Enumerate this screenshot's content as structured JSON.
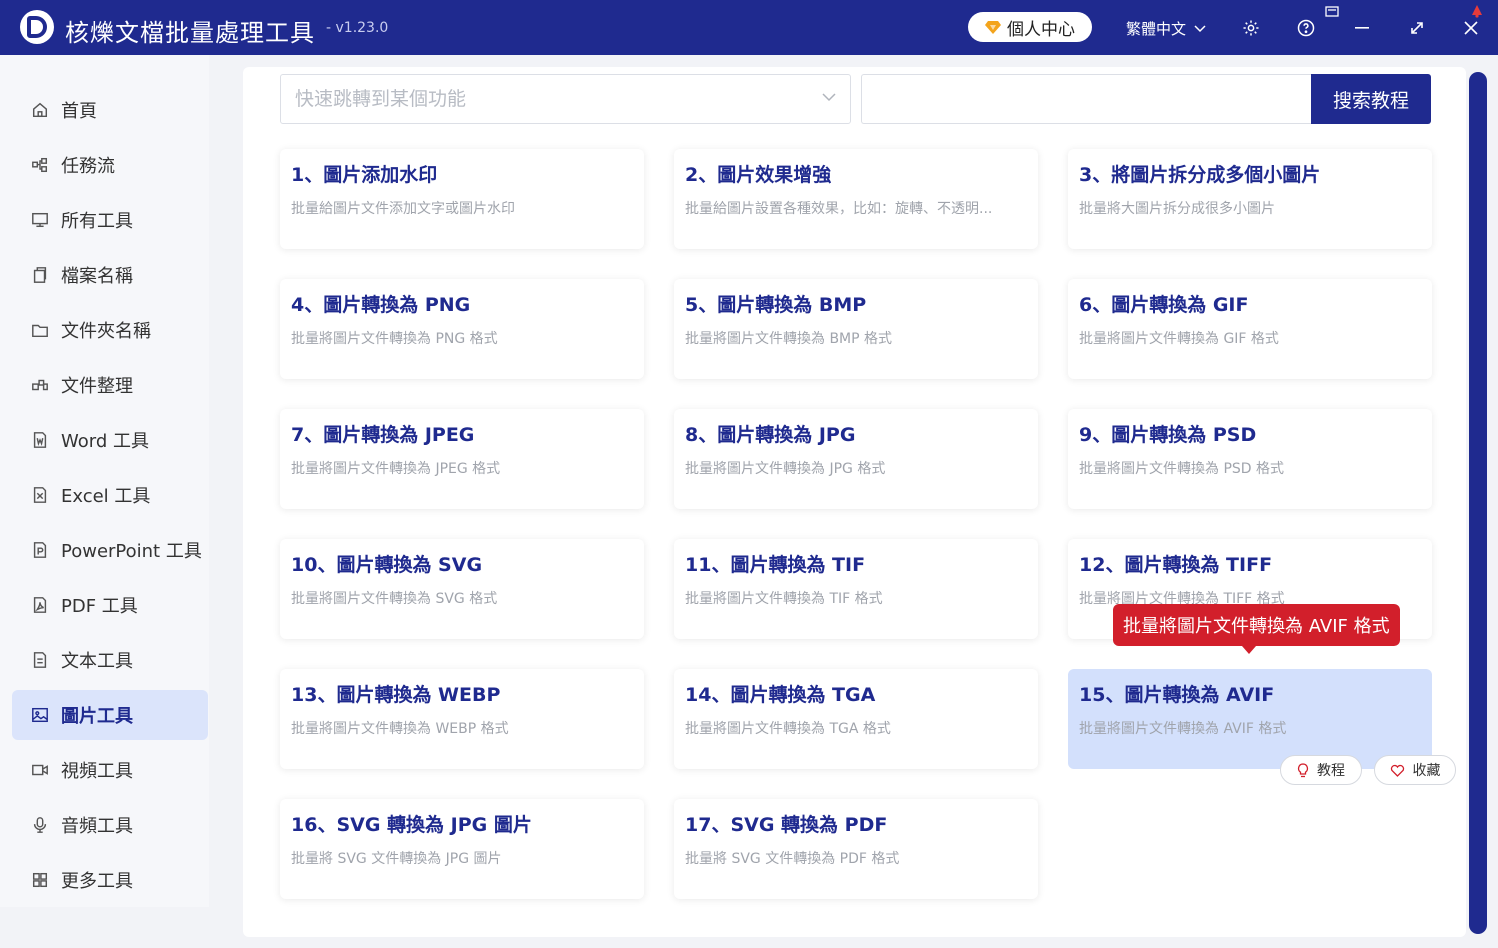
{
  "app": {
    "title": "核爍文檔批量處理工具",
    "version": "- v1.23.0",
    "user_center": "個人中心",
    "language": "繁體中文"
  },
  "sidebar": {
    "items": [
      {
        "label": "首頁",
        "icon": "home-icon",
        "active": false
      },
      {
        "label": "任務流",
        "icon": "workflow-icon",
        "active": false
      },
      {
        "label": "所有工具",
        "icon": "monitor-icon",
        "active": false
      },
      {
        "label": "檔案名稱",
        "icon": "files-icon",
        "active": false
      },
      {
        "label": "文件夾名稱",
        "icon": "folder-icon",
        "active": false
      },
      {
        "label": "文件整理",
        "icon": "organize-icon",
        "active": false
      },
      {
        "label": "Word 工具",
        "icon": "word-icon",
        "active": false
      },
      {
        "label": "Excel 工具",
        "icon": "excel-icon",
        "active": false
      },
      {
        "label": "PowerPoint 工具",
        "icon": "powerpoint-icon",
        "active": false
      },
      {
        "label": "PDF 工具",
        "icon": "pdf-icon",
        "active": false
      },
      {
        "label": "文本工具",
        "icon": "text-icon",
        "active": false
      },
      {
        "label": "圖片工具",
        "icon": "image-icon",
        "active": true
      },
      {
        "label": "視頻工具",
        "icon": "video-icon",
        "active": false
      },
      {
        "label": "音頻工具",
        "icon": "microphone-icon",
        "active": false
      },
      {
        "label": "更多工具",
        "icon": "grid-icon",
        "active": false
      }
    ]
  },
  "search": {
    "jump_placeholder": "快速跳轉到某個功能",
    "tutorial_value": "",
    "tutorial_button": "搜索教程"
  },
  "tools": [
    {
      "title": "1、圖片添加水印",
      "desc": "批量給圖片文件添加文字或圖片水印"
    },
    {
      "title": "2、圖片效果增強",
      "desc": "批量給圖片設置各種效果，比如：旋轉、不透明..."
    },
    {
      "title": "3、將圖片拆分成多個小圖片",
      "desc": "批量將大圖片拆分成很多小圖片"
    },
    {
      "title": "4、圖片轉換為 PNG",
      "desc": "批量將圖片文件轉換為 PNG 格式"
    },
    {
      "title": "5、圖片轉換為 BMP",
      "desc": "批量將圖片文件轉換為 BMP 格式"
    },
    {
      "title": "6、圖片轉換為 GIF",
      "desc": "批量將圖片文件轉換為 GIF 格式"
    },
    {
      "title": "7、圖片轉換為 JPEG",
      "desc": "批量將圖片文件轉換為 JPEG 格式"
    },
    {
      "title": "8、圖片轉換為 JPG",
      "desc": "批量將圖片文件轉換為 JPG 格式"
    },
    {
      "title": "9、圖片轉換為 PSD",
      "desc": "批量將圖片文件轉換為 PSD 格式"
    },
    {
      "title": "10、圖片轉換為 SVG",
      "desc": "批量將圖片文件轉換為 SVG 格式"
    },
    {
      "title": "11、圖片轉換為 TIF",
      "desc": "批量將圖片文件轉換為 TIF 格式"
    },
    {
      "title": "12、圖片轉換為 TIFF",
      "desc": "批量將圖片文件轉換為 TIFF 格式"
    },
    {
      "title": "13、圖片轉換為 WEBP",
      "desc": "批量將圖片文件轉換為 WEBP 格式"
    },
    {
      "title": "14、圖片轉換為 TGA",
      "desc": "批量將圖片文件轉換為 TGA 格式"
    },
    {
      "title": "15、圖片轉換為 AVIF",
      "desc": "批量將圖片文件轉換為 AVIF 格式"
    },
    {
      "title": "16、SVG 轉換為 JPG 圖片",
      "desc": "批量將 SVG 文件轉換為 JPG 圖片"
    },
    {
      "title": "17、SVG 轉換為 PDF",
      "desc": "批量將 SVG 文件轉換為 PDF 格式"
    }
  ],
  "tooltip": "批量將圖片文件轉換為 AVIF 格式",
  "card_actions": {
    "tutorial": "教程",
    "favorite": "收藏"
  },
  "colors": {
    "primary": "#1f2a8f",
    "tooltip": "#d21f2b",
    "highlight": "#d3e0fc"
  }
}
